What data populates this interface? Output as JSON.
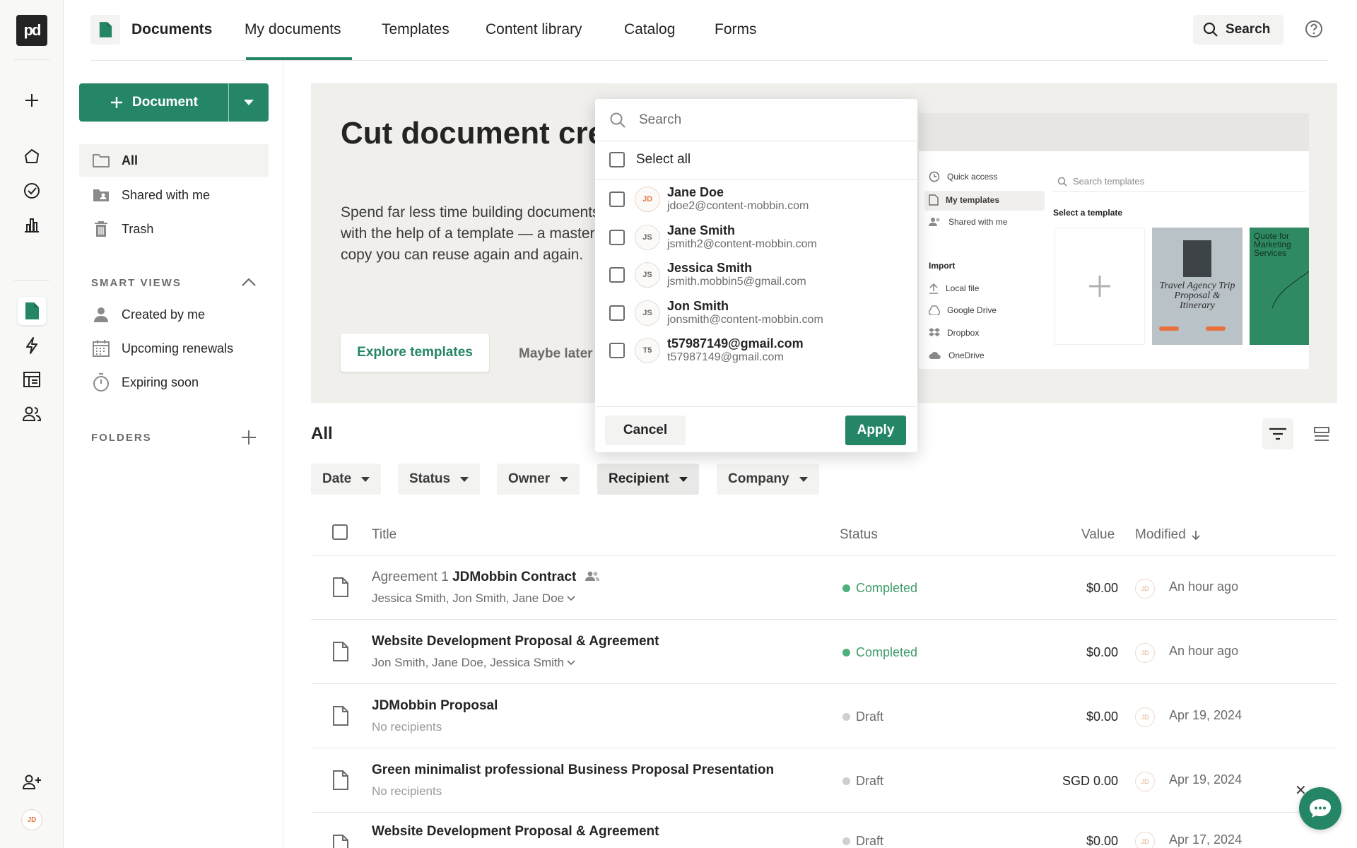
{
  "rail": {
    "logo": "pd",
    "avatar": "JD"
  },
  "topnav": {
    "title": "Documents",
    "tabs": [
      "My documents",
      "Templates",
      "Content library",
      "Catalog",
      "Forms"
    ],
    "search_label": "Search"
  },
  "sidebar": {
    "new_button": "Document",
    "items": [
      "All",
      "Shared with me",
      "Trash"
    ],
    "smart_views_heading": "SMART VIEWS",
    "smart_views": [
      "Created by me",
      "Upcoming renewals",
      "Expiring soon"
    ],
    "folders_heading": "FOLDERS"
  },
  "banner": {
    "title": "Cut document creation time by 50%",
    "text": "Spend far less time building documents with the help of a template — a master copy you can reuse again and again.",
    "explore_button": "Explore templates",
    "maybe_button": "Maybe later",
    "preview": {
      "quick_access": "Quick access",
      "my_templates": "My templates",
      "shared_with_me": "Shared with me",
      "import_heading": "Import",
      "local_file": "Local file",
      "google_drive": "Google Drive",
      "dropbox": "Dropbox",
      "onedrive": "OneDrive",
      "search_placeholder": "Search templates",
      "select_template": "Select a template",
      "card_travel": "Travel Agency Trip Proposal & Itinerary",
      "card_quote": "Quote for Marketing Services"
    }
  },
  "list": {
    "title": "All",
    "filters": [
      "Date",
      "Status",
      "Owner",
      "Recipient",
      "Company"
    ],
    "columns": {
      "title": "Title",
      "status": "Status",
      "value": "Value",
      "modified": "Modified"
    },
    "rows": [
      {
        "prefix": "Agreement 1",
        "title": "JDMobbin Contract",
        "sub": "Jessica Smith, Jon Smith, Jane Doe",
        "status": "Completed",
        "value": "$0.00",
        "owner": "JD",
        "modified": "An hour ago"
      },
      {
        "prefix": "",
        "title": "Website Development Proposal & Agreement",
        "sub": "Jon Smith, Jane Doe, Jessica Smith",
        "status": "Completed",
        "value": "$0.00",
        "owner": "JD",
        "modified": "An hour ago"
      },
      {
        "prefix": "",
        "title": "JDMobbin Proposal",
        "sub": "No recipients",
        "status": "Draft",
        "value": "$0.00",
        "owner": "JD",
        "modified": "Apr 19, 2024"
      },
      {
        "prefix": "",
        "title": "Green minimalist professional Business Proposal Presentation",
        "sub": "No recipients",
        "status": "Draft",
        "value": "SGD 0.00",
        "owner": "JD",
        "modified": "Apr 19, 2024"
      },
      {
        "prefix": "",
        "title": "Website Development Proposal & Agreement",
        "sub": "",
        "status": "Draft",
        "value": "$0.00",
        "owner": "JD",
        "modified": "Apr 17, 2024"
      }
    ]
  },
  "popover": {
    "search_placeholder": "Search",
    "select_all": "Select all",
    "options": [
      {
        "initials": "JD",
        "name": "Jane Doe",
        "email": "jdoe2@content-mobbin.com"
      },
      {
        "initials": "JS",
        "name": "Jane Smith",
        "email": "jsmith2@content-mobbin.com"
      },
      {
        "initials": "JS",
        "name": "Jessica Smith",
        "email": "jsmith.mobbin5@gmail.com"
      },
      {
        "initials": "JS",
        "name": "Jon Smith",
        "email": "jonsmith@content-mobbin.com"
      },
      {
        "initials": "T5",
        "name": "t57987149@gmail.com",
        "email": "t57987149@gmail.com"
      }
    ],
    "cancel": "Cancel",
    "apply": "Apply"
  },
  "colors": {
    "brand": "#248567",
    "completed": "#4fb07a",
    "draft": "#cfcfcf"
  }
}
